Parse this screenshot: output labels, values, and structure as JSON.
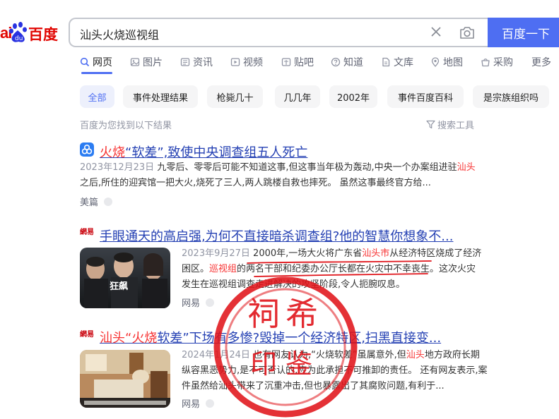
{
  "logo": {
    "part_a": "ai",
    "part_b": "百度"
  },
  "search": {
    "query": "汕头火烧巡视组",
    "button": "百度一下"
  },
  "tabs": [
    {
      "label": "网页",
      "icon": "search-icon"
    },
    {
      "label": "图片",
      "icon": "image-icon"
    },
    {
      "label": "资讯",
      "icon": "news-icon"
    },
    {
      "label": "视频",
      "icon": "video-icon"
    },
    {
      "label": "贴吧",
      "icon": "tieba-icon"
    },
    {
      "label": "知道",
      "icon": "question-icon"
    },
    {
      "label": "文库",
      "icon": "document-icon"
    },
    {
      "label": "地图",
      "icon": "map-pin-icon"
    },
    {
      "label": "采购",
      "icon": "purchase-icon"
    },
    {
      "label": "更多",
      "icon": ""
    }
  ],
  "chips": [
    "全部",
    "事件处理结果",
    "枪毙几十",
    "几几年",
    "2002年",
    "事件百度百科",
    "是宗族组织吗"
  ],
  "meta": {
    "found": "百度为您找到以下结果",
    "tools": "搜索工具"
  },
  "results": [
    {
      "title_em": "火烧",
      "title_rest": "“软差”,致使中央调查组五人死亡",
      "date": "2023年12月23日",
      "line1_a": "九零后、零零后可能不知道这事,但这事当年极为轰动,中央一个办案组进驻",
      "line1_em": "汕头",
      "line2": "之后,所住的迎宾馆一把大火,烧死了三人,两人跳楼自救也摔死。 虽然这事最终官方给...",
      "source": "美篇"
    },
    {
      "site_label": "網易",
      "title": "手眼通天的高启强,为何不直接暗杀调查组?他的智慧你想象不...",
      "date": "2023年9月27日",
      "line1_a": "2000年,一场大火将广东省",
      "line1_em": "汕头市",
      "line1_b": "从经济特区烧成了经济",
      "line2_a": "困区。",
      "line2_em": "巡视组",
      "line2_b": "的两名干部和纪委办公厅长都在火灾中不幸丧生。这次火灾",
      "line3": "发生在巡视组调查走进解决的攻坚阶段,令人扼腕叹息。",
      "source": "网易",
      "thumb_text": "狂飙"
    },
    {
      "site_label": "網易",
      "title_a": "汕头",
      "title_em": "“火烧",
      "title_b": "软差”下场有多惨?毁掉一个经济特区,扫黑直接变...",
      "date": "2024年1月24日",
      "line1_a": "也有网友认为,“火烧软差”虽属意外,但",
      "line1_em": "汕头",
      "line1_b": "地方政府长期",
      "line2": "纵容黑恶势力,是不可否认的,应为此承担不可推卸的责任。 还有网友表示,案",
      "line3": "件虽然给汕头带来了沉重冲击,但也暴露出了其腐败问题,有利于...",
      "source": "网易"
    }
  ],
  "stamp": {
    "line1": "祠希",
    "line2": "印鉴"
  },
  "colors": {
    "accent": "#4e6ef2",
    "brand_red": "#e10602",
    "em_red": "#f73131",
    "link": "#2440b3",
    "stamp": "#e0141a"
  }
}
